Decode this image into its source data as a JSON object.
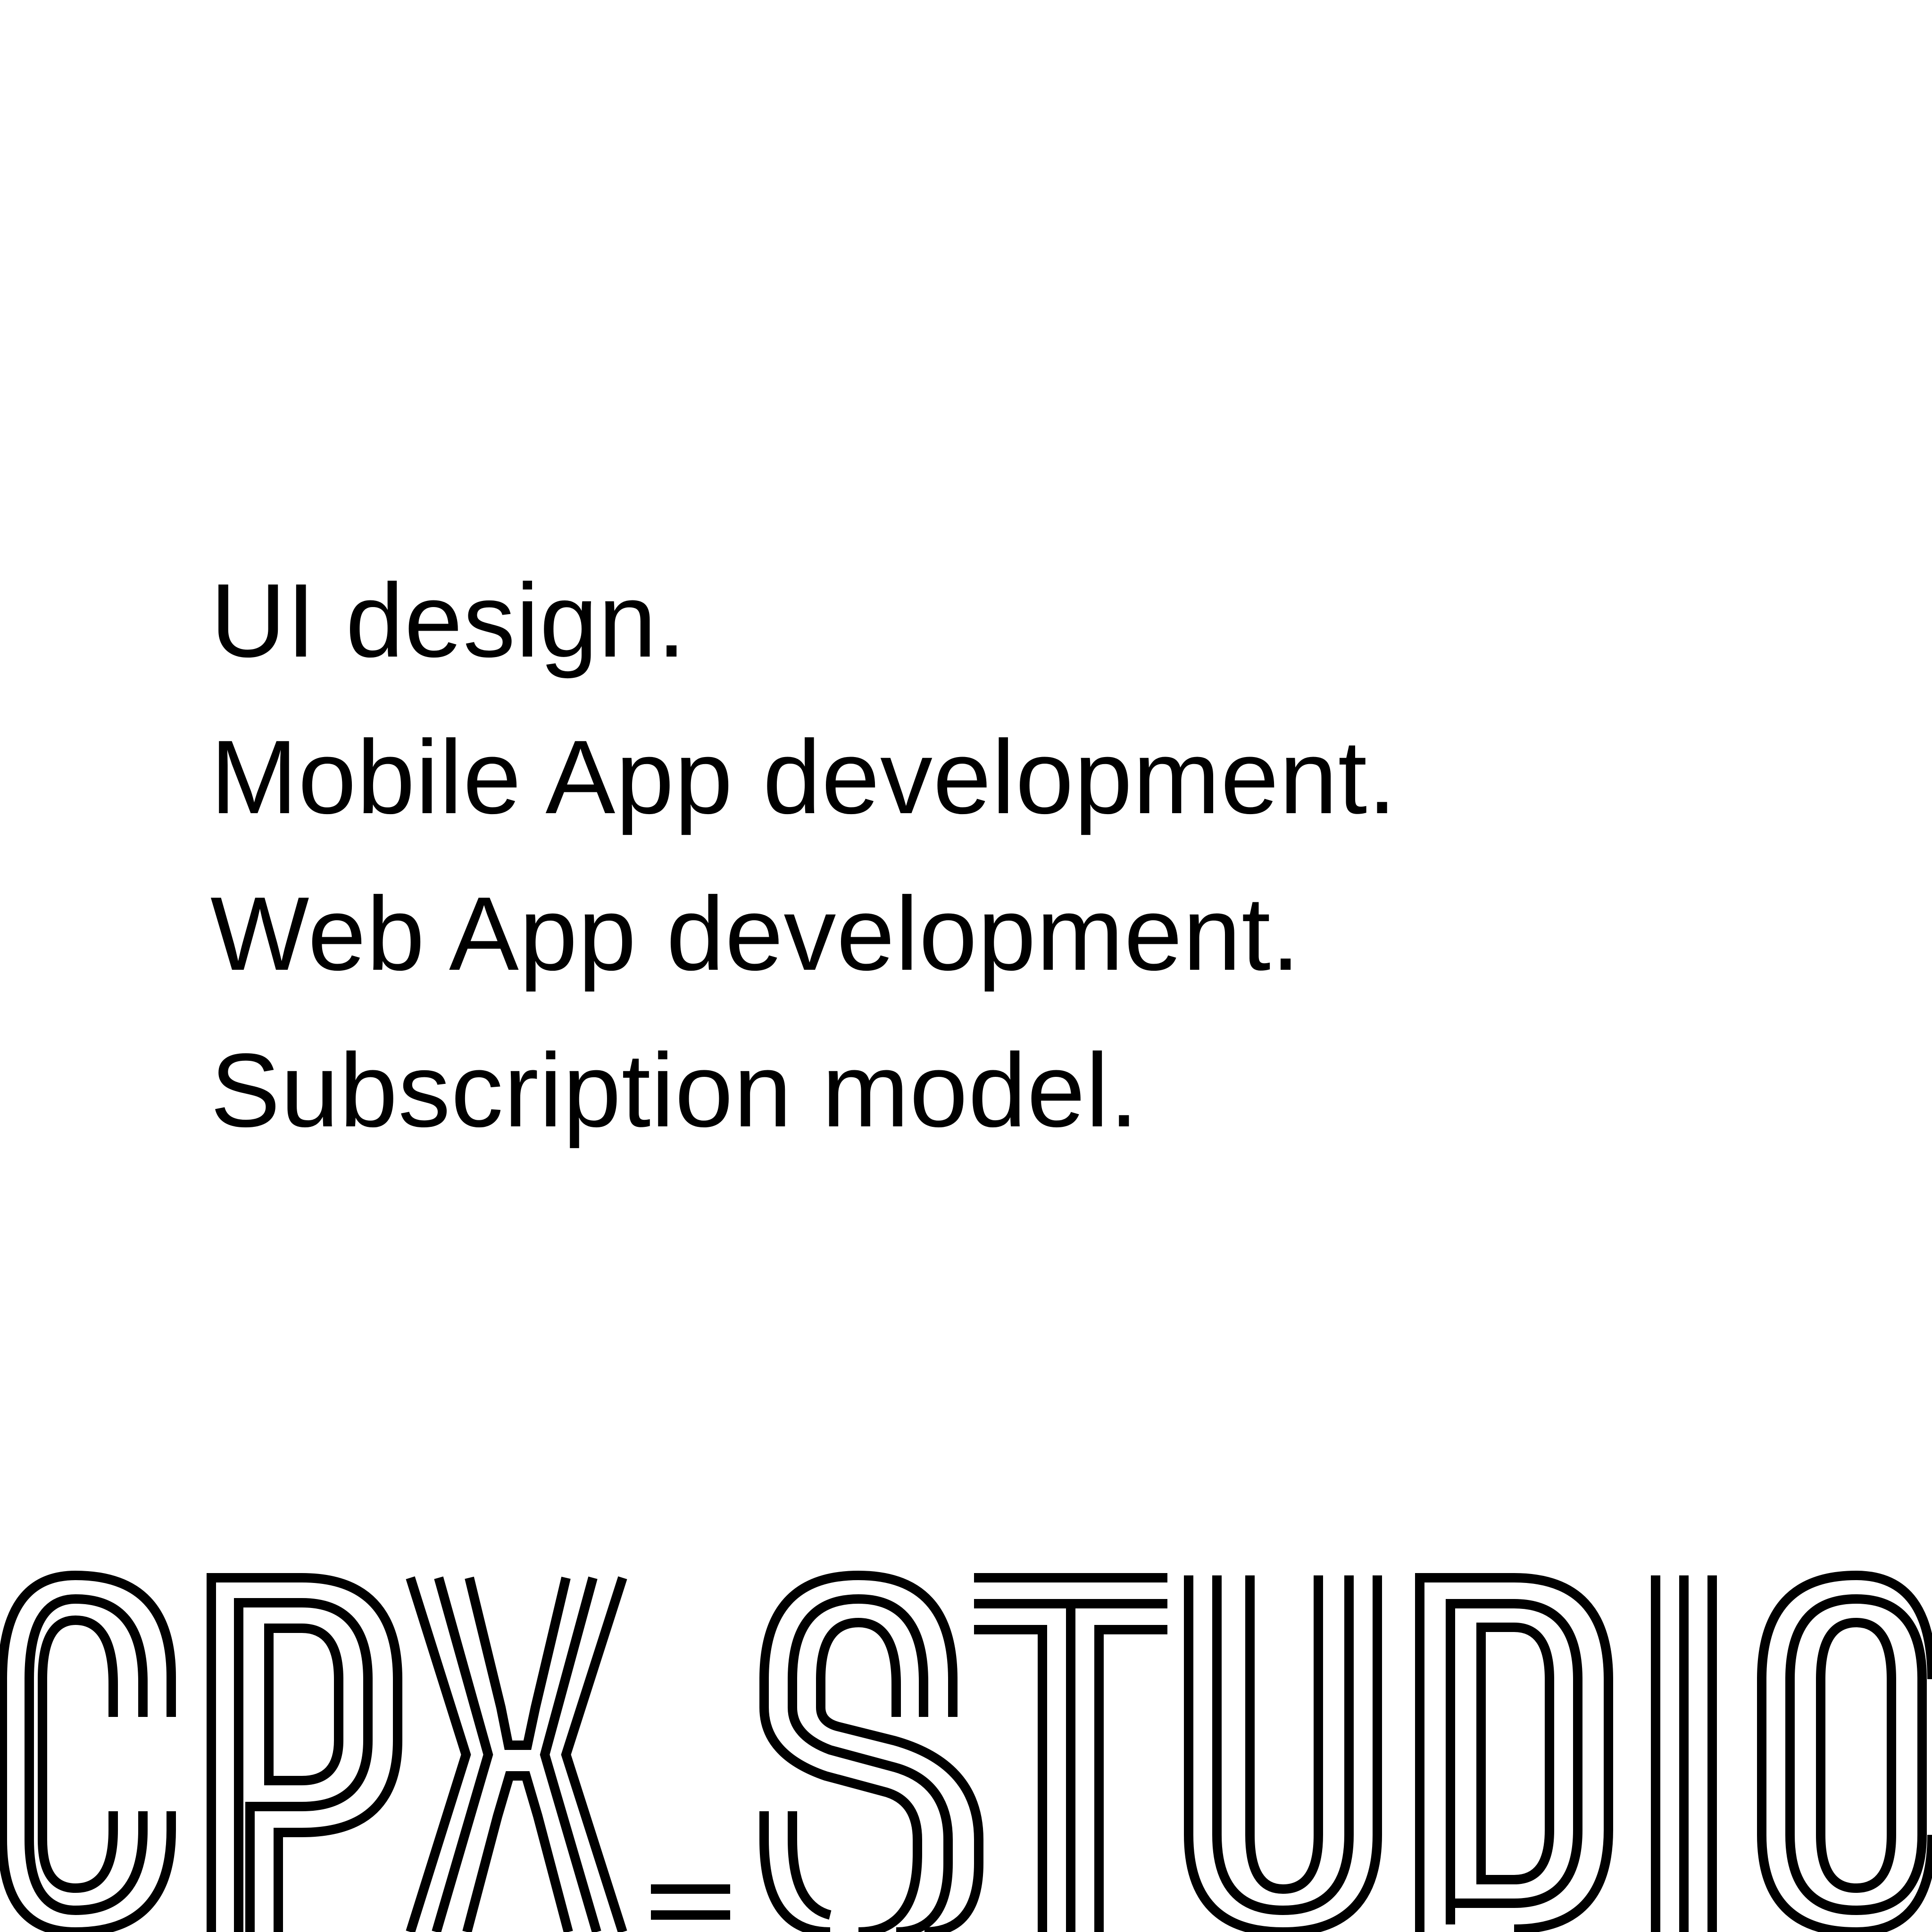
{
  "services": [
    {
      "label": "UI design."
    },
    {
      "label": "Mobile App development."
    },
    {
      "label": "Web App development."
    },
    {
      "label": "Subscription model."
    }
  ],
  "brand": {
    "wordmark": "CPX_STUDIO",
    "ink_color": "#000000",
    "background_color": "#ffffff"
  }
}
